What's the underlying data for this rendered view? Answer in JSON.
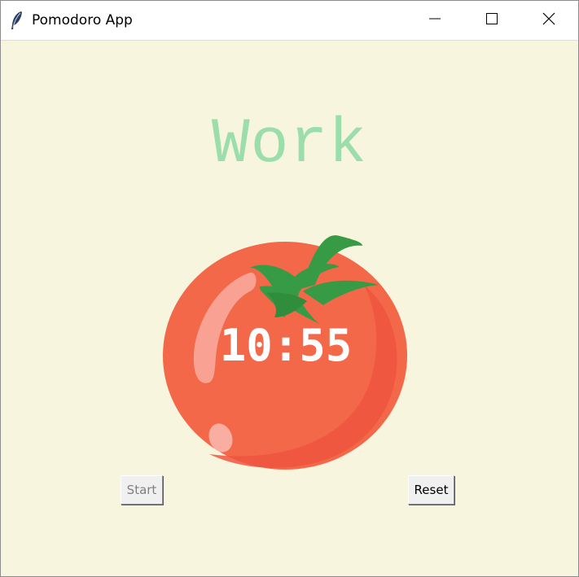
{
  "window": {
    "title": "Pomodoro App",
    "icon": "feather-icon"
  },
  "controls": {
    "minimize_icon": "minimize-icon",
    "maximize_icon": "maximize-icon",
    "close_icon": "close-icon"
  },
  "app": {
    "mode_label": "Work",
    "timer": "10:55",
    "start_label": "Start",
    "reset_label": "Reset",
    "start_enabled": false
  },
  "colors": {
    "background": "#f7f5dd",
    "mode_label": "#9bdeac",
    "tomato": "#f26849",
    "leaf": "#379b46",
    "timer_text": "#ffffff"
  }
}
